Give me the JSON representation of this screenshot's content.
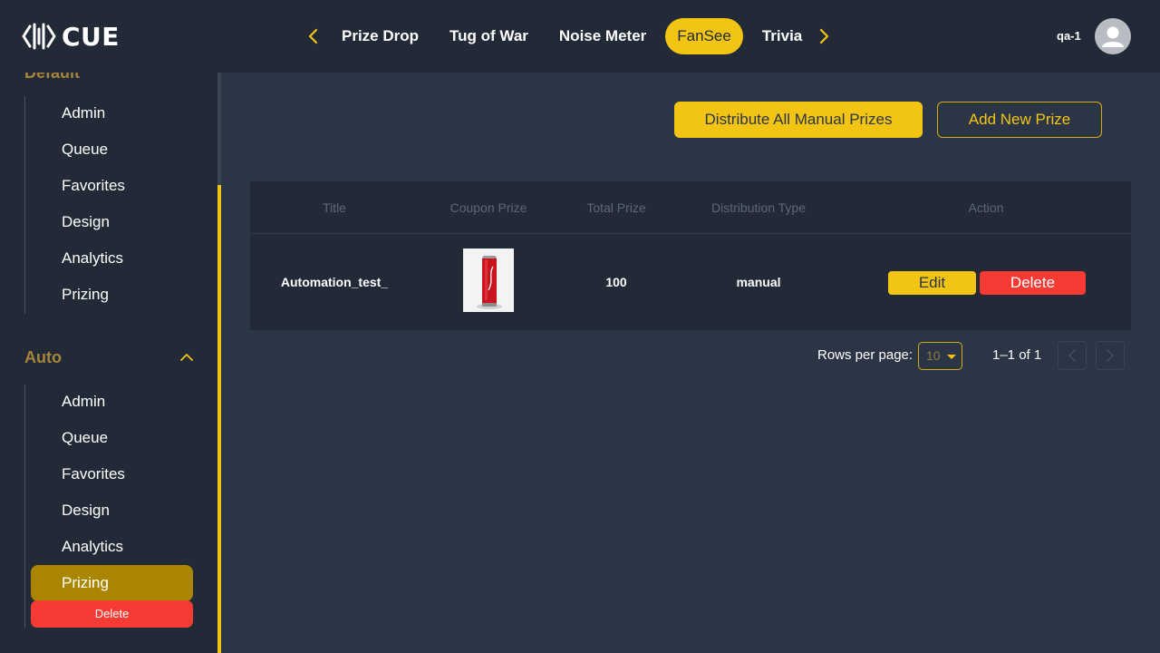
{
  "header": {
    "logo_text": "CUE",
    "tabs": [
      {
        "label": "Prize Drop"
      },
      {
        "label": "Tug of War"
      },
      {
        "label": "Noise Meter"
      },
      {
        "label": "FanSee"
      },
      {
        "label": "Trivia"
      }
    ],
    "active_tab": "FanSee",
    "username": "qa-1",
    "icons": {
      "prev": "chevron-left-icon",
      "next": "chevron-right-icon",
      "avatar": "user-avatar-icon"
    }
  },
  "sidebar": {
    "section_top_label": "Default",
    "default_items": [
      {
        "label": "Admin"
      },
      {
        "label": "Queue"
      },
      {
        "label": "Favorites"
      },
      {
        "label": "Design"
      },
      {
        "label": "Analytics"
      },
      {
        "label": "Prizing"
      }
    ],
    "auto_section_label": "Auto",
    "auto_items": [
      {
        "label": "Admin"
      },
      {
        "label": "Queue"
      },
      {
        "label": "Favorites"
      },
      {
        "label": "Design"
      },
      {
        "label": "Analytics"
      },
      {
        "label": "Prizing"
      }
    ],
    "active_item": "Prizing",
    "delete_label": "Delete"
  },
  "toolbar": {
    "distribute_label": "Distribute All Manual Prizes",
    "add_prize_label": "Add New Prize"
  },
  "table": {
    "columns": [
      "Title",
      "Coupon Prize",
      "Total Prize",
      "Distribution Type",
      "Action"
    ],
    "rows": [
      {
        "title": "Automation_test_",
        "coupon_prize_image": "coca-cola-can",
        "total_prize": "100",
        "distribution_type": "manual",
        "edit_label": "Edit",
        "delete_label": "Delete"
      }
    ]
  },
  "pagination": {
    "rows_per_page_label": "Rows per page:",
    "rows_per_page_value": "10",
    "range": "1–1 of 1"
  },
  "colors": {
    "accent": "#f2c515",
    "danger": "#f63b35",
    "panel": "#222a37",
    "background": "#2c3545",
    "active_sidebar": "#a98500"
  }
}
